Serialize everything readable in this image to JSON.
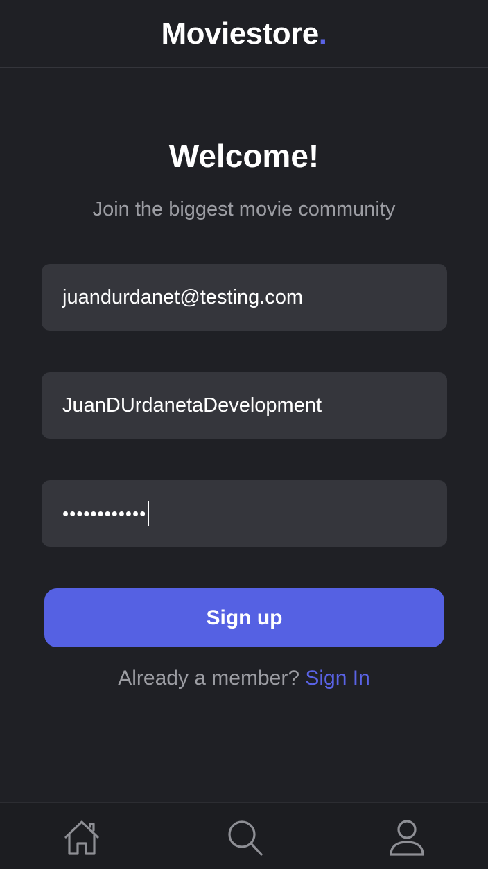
{
  "header": {
    "brand": "Moviestore",
    "brand_dot": "."
  },
  "main": {
    "title": "Welcome!",
    "subtitle": "Join the biggest movie community",
    "email_value": "juandurdanet@testing.com",
    "username_value": "JuanDUrdanetaDevelopment",
    "password_mask": "••••••••••••",
    "signup_label": "Sign up",
    "member_text": "Already a member?",
    "signin_label": "Sign In"
  },
  "tabbar": {
    "items": [
      {
        "icon": "home-icon"
      },
      {
        "icon": "search-icon"
      },
      {
        "icon": "profile-icon"
      }
    ]
  },
  "colors": {
    "background": "#1f2025",
    "field": "#35363c",
    "accent": "#5561e3",
    "muted_text": "#9c9da3"
  }
}
